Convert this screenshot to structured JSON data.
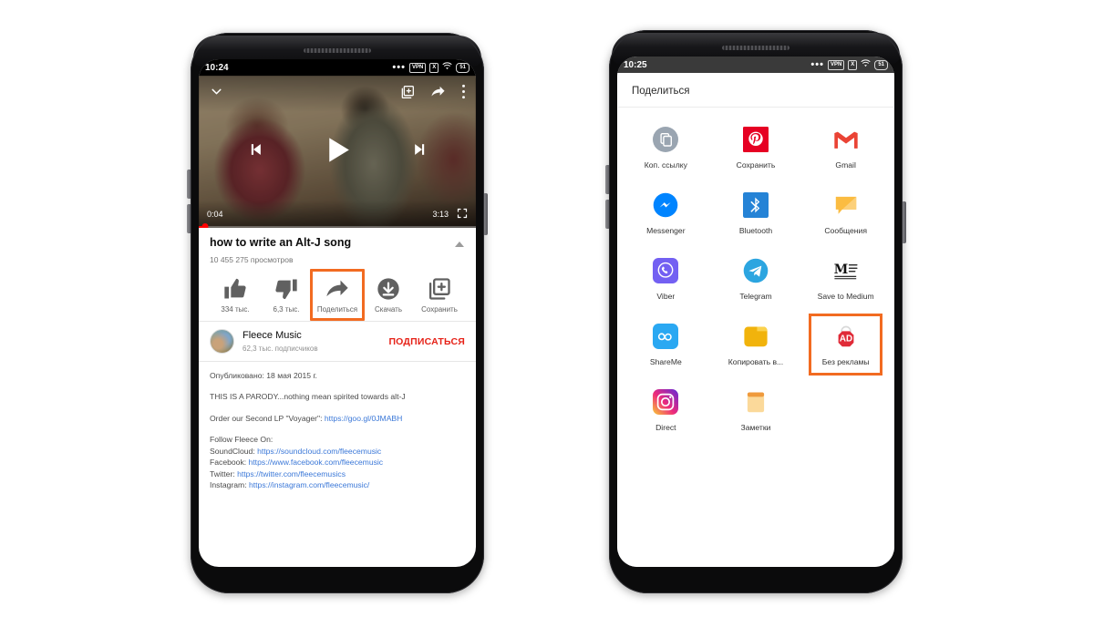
{
  "left_phone": {
    "status_bar": {
      "time": "10:24",
      "dots": "•••",
      "vpn": "VPN",
      "x_icon": "X",
      "battery": "51"
    },
    "player": {
      "collapse_icon": "chevron-down-icon",
      "add_to_playlist_icon": "add-to-queue-icon",
      "share_icon": "share-arrow-icon",
      "overflow_icon": "more-vertical-icon",
      "prev_icon": "skip-previous-icon",
      "play_icon": "play-icon",
      "next_icon": "skip-next-icon",
      "current_time": "0:04",
      "duration": "3:13",
      "fullscreen_icon": "fullscreen-icon"
    },
    "video": {
      "title": "how to write an Alt-J song",
      "views": "10 455 275 просмотров",
      "collapse_caret": "caret-up-icon"
    },
    "actions": [
      {
        "label": "334 тыс.",
        "icon": "thumbs-up-icon",
        "highlighted": false
      },
      {
        "label": "6,3 тыс.",
        "icon": "thumbs-down-icon",
        "highlighted": false
      },
      {
        "label": "Поделиться",
        "icon": "share-arrow-icon",
        "highlighted": true
      },
      {
        "label": "Скачать",
        "icon": "download-icon",
        "highlighted": false
      },
      {
        "label": "Сохранить",
        "icon": "save-to-playlist-icon",
        "highlighted": false
      }
    ],
    "channel": {
      "name": "Fleece Music",
      "subscribers": "62,3 тыс. подписчиков",
      "subscribe_label": "ПОДПИСАТЬСЯ"
    },
    "description": {
      "published": "Опубликовано: 18 мая 2015 г.",
      "parody_note": "THIS IS A PARODY...nothing mean spirited towards alt-J",
      "order_prefix": "Order our Second LP \"Voyager\": ",
      "order_link": "https://goo.gl/0JMABH",
      "follow_header": "Follow Fleece On:",
      "links": [
        {
          "label": "SoundCloud: ",
          "url": "https://soundcloud.com/fleecemusic"
        },
        {
          "label": "Facebook: ",
          "url": "https://www.facebook.com/fleecemusic"
        },
        {
          "label": "Twitter: ",
          "url": "https://twitter.com/fleecemusics"
        },
        {
          "label": "Instagram: ",
          "url": "https://instagram.com/fleecemusic/"
        }
      ]
    }
  },
  "right_phone": {
    "status_bar": {
      "time": "10:25",
      "dots": "•••",
      "vpn": "VPN",
      "x_icon": "X",
      "battery": "51"
    },
    "sheet": {
      "title": "Поделиться",
      "targets": [
        {
          "label": "Коп. ссылку",
          "icon": "copy-link-icon",
          "highlighted": false
        },
        {
          "label": "Сохранить",
          "icon": "pinterest-icon",
          "highlighted": false
        },
        {
          "label": "Gmail",
          "icon": "gmail-icon",
          "highlighted": false
        },
        {
          "label": "Messenger",
          "icon": "messenger-icon",
          "highlighted": false
        },
        {
          "label": "Bluetooth",
          "icon": "bluetooth-icon",
          "highlighted": false
        },
        {
          "label": "Сообщения",
          "icon": "messages-icon",
          "highlighted": false
        },
        {
          "label": "Viber",
          "icon": "viber-icon",
          "highlighted": false
        },
        {
          "label": "Telegram",
          "icon": "telegram-icon",
          "highlighted": false
        },
        {
          "label": "Save to Medium",
          "icon": "medium-icon",
          "highlighted": false
        },
        {
          "label": "ShareMe",
          "icon": "shareme-icon",
          "highlighted": false
        },
        {
          "label": "Копировать в...",
          "icon": "file-manager-icon",
          "highlighted": false
        },
        {
          "label": "Без рекламы",
          "icon": "adguard-icon",
          "highlighted": true
        },
        {
          "label": "Direct",
          "icon": "instagram-direct-icon",
          "highlighted": false
        },
        {
          "label": "Заметки",
          "icon": "notes-icon",
          "highlighted": false
        }
      ]
    }
  },
  "colors": {
    "highlight": "#f26b21",
    "youtube_red": "#e62117",
    "link_blue": "#3b78d8"
  }
}
